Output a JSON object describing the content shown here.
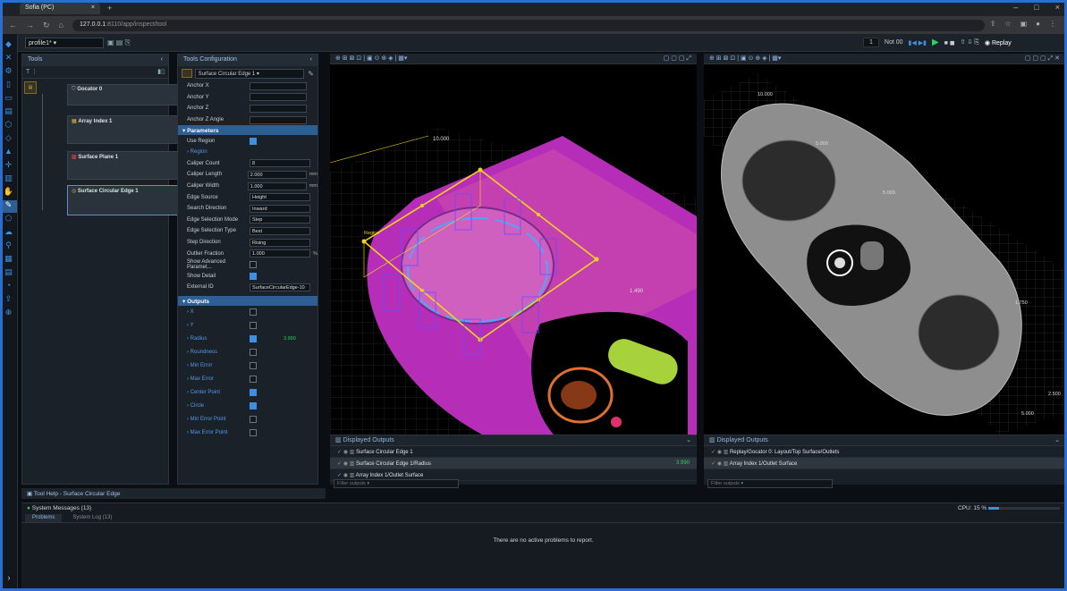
{
  "browser": {
    "tab_title": "Sofia (PC)",
    "url_host": "127.0.0.1",
    "url_path": ":8110/app/inspect/tool",
    "profile_label": "Replay"
  },
  "app": {
    "job_name": "profile1*",
    "frame_counter": "1",
    "status_value": "Not 00",
    "replay_label": "Replay"
  },
  "tools_panel": {
    "title": "Tools",
    "tools": [
      {
        "label": "Gocator 0"
      },
      {
        "label": "Array Index 1"
      },
      {
        "label": "Surface Plane 1"
      },
      {
        "label": "Surface Circular Edge 1"
      }
    ]
  },
  "config_panel": {
    "title": "Tools Configuration",
    "tool_select": "Surface Circular Edge 1",
    "anchor_rows": [
      {
        "label": "Anchor X"
      },
      {
        "label": "Anchor Y"
      },
      {
        "label": "Anchor Z"
      },
      {
        "label": "Anchor Z Angle"
      }
    ],
    "parameters_header": "Parameters",
    "use_region_label": "Use Region",
    "region_label": "Region",
    "params": [
      {
        "label": "Caliper Count",
        "value": "8",
        "unit": ""
      },
      {
        "label": "Caliper Length",
        "value": "2.000",
        "unit": "mm"
      },
      {
        "label": "Caliper Width",
        "value": "1.000",
        "unit": "mm"
      },
      {
        "label": "Edge Source",
        "value": "Height",
        "unit": ""
      },
      {
        "label": "Search Direction",
        "value": "Inward",
        "unit": ""
      },
      {
        "label": "Edge Selection Mode",
        "value": "Step",
        "unit": ""
      },
      {
        "label": "Edge Selection Type",
        "value": "Best",
        "unit": ""
      },
      {
        "label": "Step Direction",
        "value": "Rising",
        "unit": ""
      },
      {
        "label": "Outlier Fraction",
        "value": "1.000",
        "unit": "%"
      }
    ],
    "show_advanced_label": "Show Advanced Paramet...",
    "show_detail_label": "Show Detail",
    "external_id_label": "External ID",
    "external_id_value": "SurfaceCircularEdge-10",
    "outputs_header": "Outputs",
    "outputs": [
      {
        "label": "X",
        "checked": false,
        "value": ""
      },
      {
        "label": "Y",
        "checked": false,
        "value": ""
      },
      {
        "label": "Radius",
        "checked": true,
        "value": "3.990"
      },
      {
        "label": "Roundness",
        "checked": false,
        "value": ""
      },
      {
        "label": "Min Error",
        "checked": false,
        "value": ""
      },
      {
        "label": "Max Error",
        "checked": false,
        "value": ""
      },
      {
        "label": "Center Point",
        "checked": true,
        "value": ""
      },
      {
        "label": "Circle",
        "checked": true,
        "value": ""
      },
      {
        "label": "Min Error Point",
        "checked": false,
        "value": ""
      },
      {
        "label": "Max Error Point",
        "checked": false,
        "value": ""
      }
    ]
  },
  "viewport_left": {
    "labels": {
      "top": "10.000",
      "side": "1.490",
      "region": "Region"
    },
    "displayed_outputs_title": "Displayed Outputs",
    "outputs": [
      {
        "label": "Surface Circular Edge 1",
        "value": "",
        "selected": false
      },
      {
        "label": "Surface Circular Edge 1/Radius",
        "value": "3.990",
        "selected": true
      },
      {
        "label": "Array Index 1/Outlet Surface",
        "value": "",
        "selected": false
      }
    ],
    "filter_placeholder": "Filter outputs"
  },
  "viewport_right": {
    "labels": {
      "a": "10.000",
      "b": "5.000",
      "c": "5.000",
      "d": "1.750",
      "e": "2.500",
      "f": "5.000"
    },
    "displayed_outputs_title": "Displayed Outputs",
    "outputs": [
      {
        "label": "Replay/Gocator 0: Layout/Top Surface/Outlets",
        "value": "",
        "selected": false
      },
      {
        "label": "Array Index 1/Outlet Surface",
        "value": "",
        "selected": true
      }
    ],
    "filter_placeholder": "Filter outputs"
  },
  "bottom": {
    "tool_help": "Tool Help - Surface Circular Edge",
    "system_messages": "System Messages (13)",
    "tabs": [
      {
        "label": "Problems"
      },
      {
        "label": "System Log (13)"
      }
    ],
    "empty_message": "There are no active problems to report.",
    "cpu_label": "CPU: 15 %"
  },
  "colors": {
    "accent": "#3d8fe0",
    "magenta": "#c632c8",
    "yellow": "#f2d21a",
    "green": "#a8d23c"
  }
}
